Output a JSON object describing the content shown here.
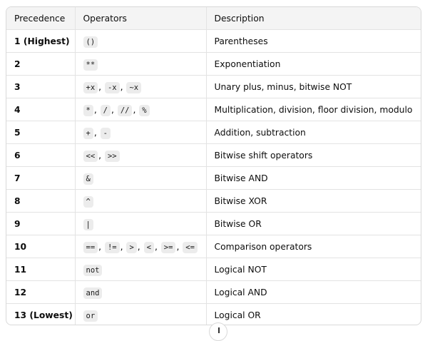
{
  "table": {
    "headers": [
      "Precedence",
      "Operators",
      "Description"
    ],
    "rows": [
      {
        "precedence": "1 (Highest)",
        "operators": [
          "()"
        ],
        "description": "Parentheses"
      },
      {
        "precedence": "2",
        "operators": [
          "**"
        ],
        "description": "Exponentiation"
      },
      {
        "precedence": "3",
        "operators": [
          "+x",
          "-x",
          "~x"
        ],
        "description": "Unary plus, minus, bitwise NOT"
      },
      {
        "precedence": "4",
        "operators": [
          "*",
          "/",
          "//",
          "%"
        ],
        "description": "Multiplication, division, floor division, modulo"
      },
      {
        "precedence": "5",
        "operators": [
          "+",
          "-"
        ],
        "description": "Addition, subtraction"
      },
      {
        "precedence": "6",
        "operators": [
          "<<",
          ">>"
        ],
        "description": "Bitwise shift operators"
      },
      {
        "precedence": "7",
        "operators": [
          "&"
        ],
        "description": "Bitwise AND"
      },
      {
        "precedence": "8",
        "operators": [
          "^"
        ],
        "description": "Bitwise XOR"
      },
      {
        "precedence": "9",
        "operators": [
          "|"
        ],
        "description": "Bitwise OR"
      },
      {
        "precedence": "10",
        "operators": [
          "==",
          "!=",
          ">",
          "<",
          ">=",
          "<="
        ],
        "description": "Comparison operators"
      },
      {
        "precedence": "11",
        "operators": [
          "not"
        ],
        "description": "Logical NOT"
      },
      {
        "precedence": "12",
        "operators": [
          "and"
        ],
        "description": "Logical AND"
      },
      {
        "precedence": "13 (Lowest)",
        "operators": [
          "or"
        ],
        "description": "Logical OR"
      }
    ]
  },
  "icons": {
    "scroll_down": "arrow-down-icon"
  }
}
